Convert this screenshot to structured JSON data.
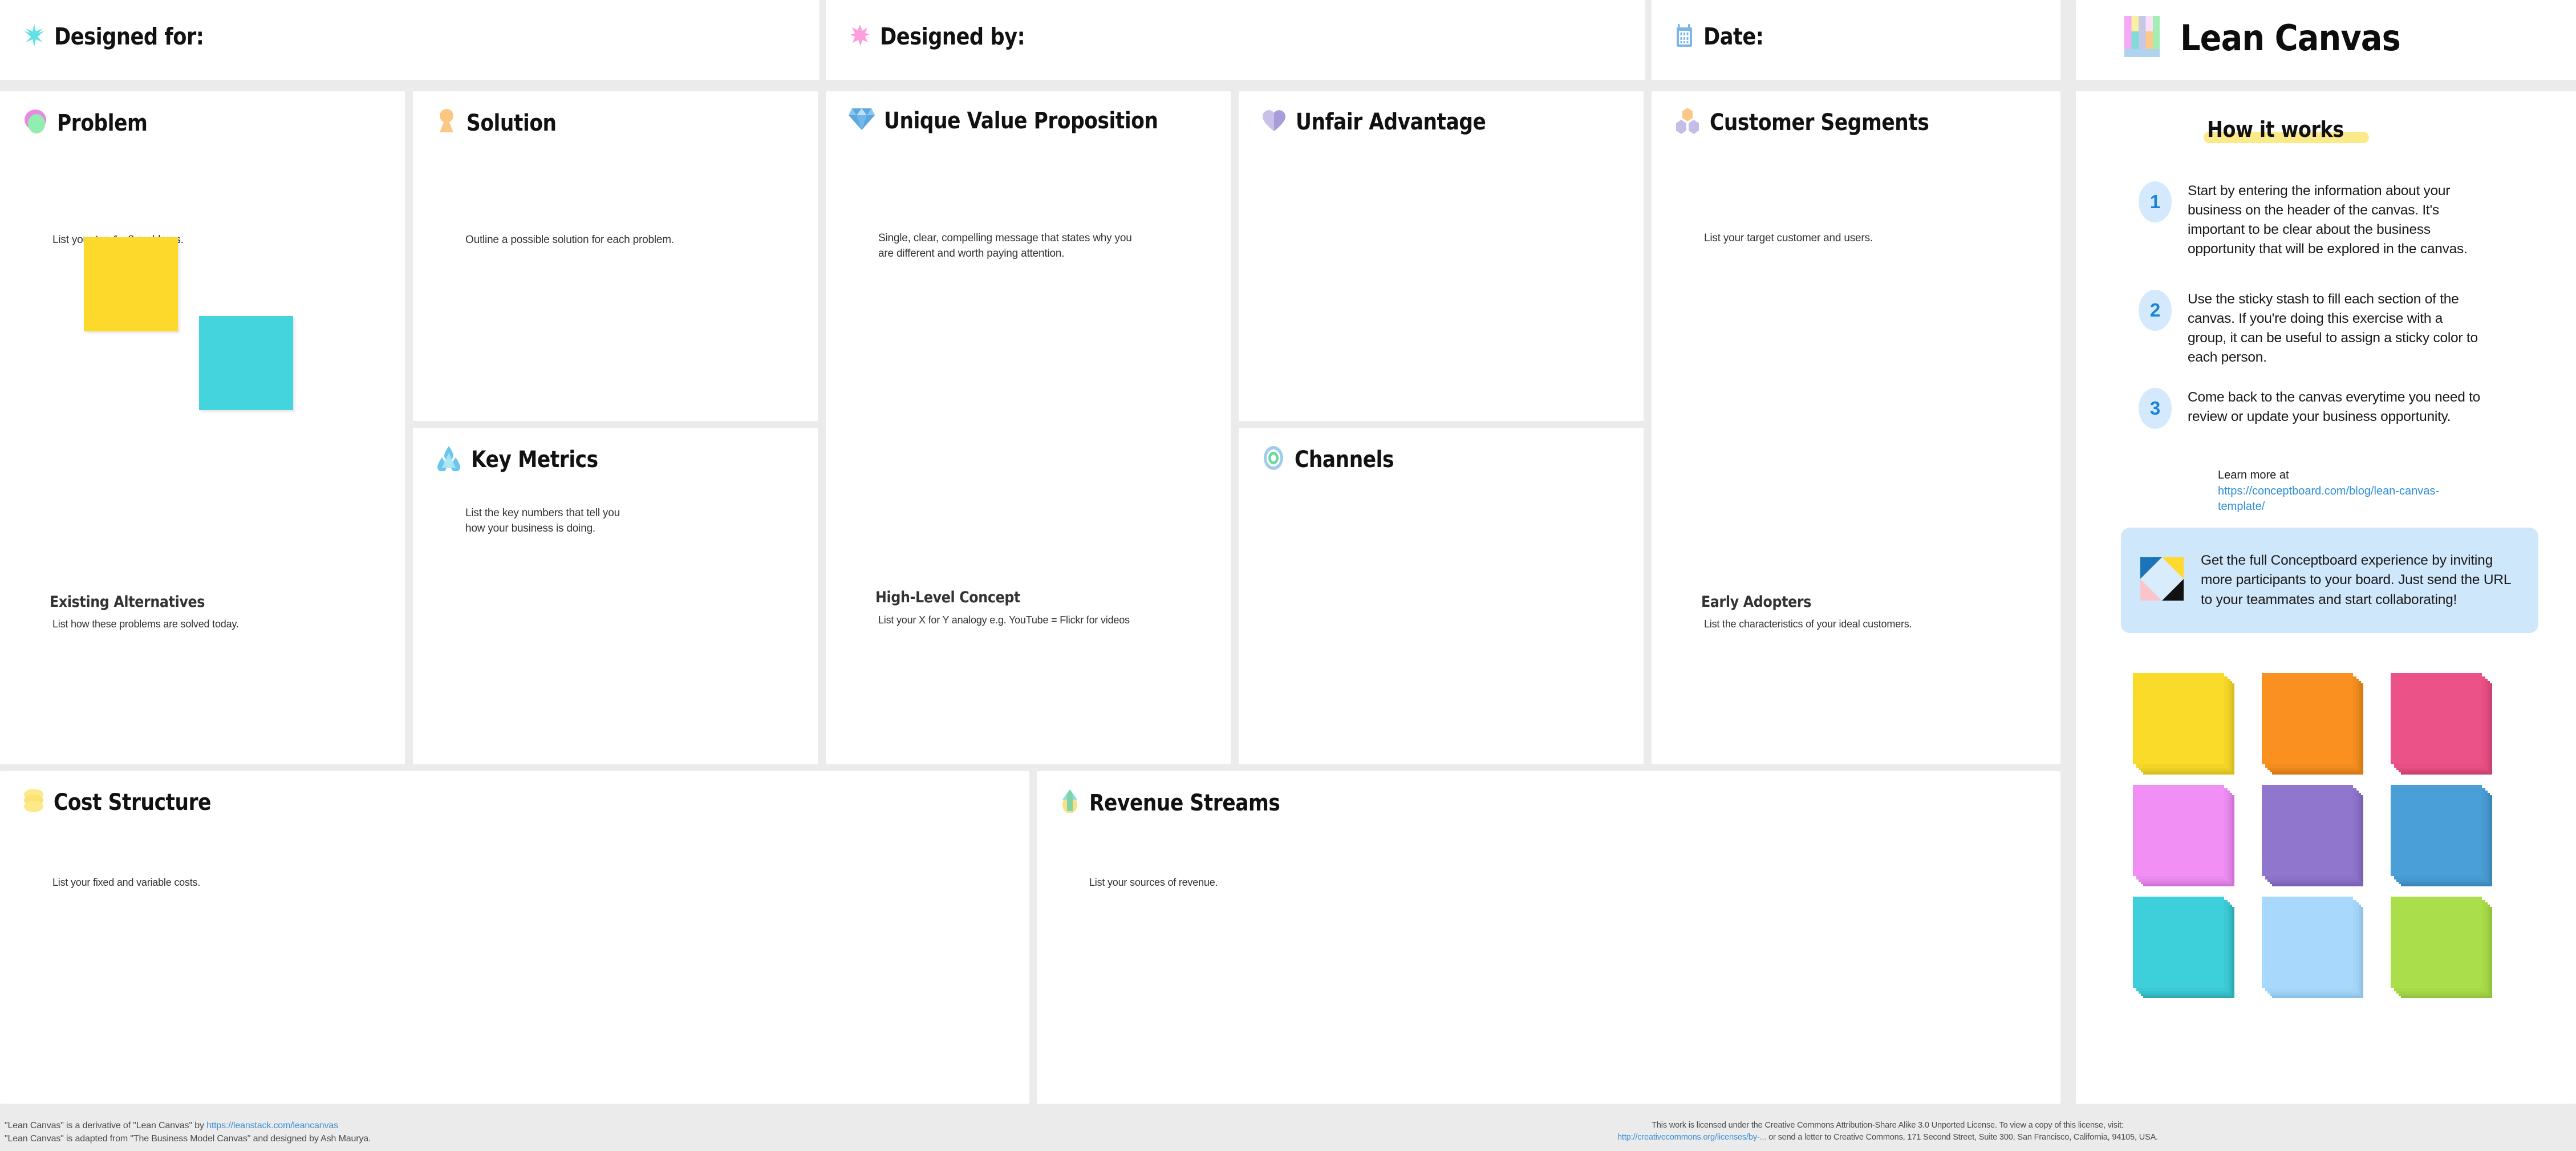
{
  "header": {
    "designed_for": {
      "label": "Designed for:",
      "icon": "asterisk-burst-icon",
      "color": "#5fe0e6"
    },
    "designed_by": {
      "label": "Designed by:",
      "icon": "star-burst-icon",
      "color": "#ff9ede"
    },
    "date": {
      "label": "Date:",
      "icon": "calendar-icon",
      "color": "#7cb6e8"
    },
    "brand": {
      "title": "Lean Canvas",
      "icon": "lean-canvas-logo-icon"
    }
  },
  "sections": {
    "problem": {
      "title": "Problem",
      "desc": "List your top 1 - 3 problems.",
      "icon": "oval-pink-green-icon",
      "sub_title": "Existing Alternatives",
      "sub_desc": "List how these problems are solved today."
    },
    "solution": {
      "title": "Solution",
      "desc": "Outline a possible solution for each problem.",
      "icon": "keyhole-icon"
    },
    "key_metrics": {
      "title": "Key Metrics",
      "desc": "List the key numbers that tell you\nhow your business is doing.",
      "icon": "three-droplets-icon"
    },
    "uvp": {
      "title": "Unique Value Proposition",
      "desc": "Single, clear, compelling message that states why you are different and worth paying attention.",
      "icon": "diamond-gem-icon",
      "sub_title": "High-Level Concept",
      "sub_desc": "List your X for Y analogy e.g. YouTube = Flickr for videos"
    },
    "unfair_advantage": {
      "title": "Unfair Advantage",
      "desc": "",
      "icon": "purple-heart-icon"
    },
    "channels": {
      "title": "Channels",
      "desc": "",
      "icon": "target-circles-icon"
    },
    "customer_segments": {
      "title": "Customer Segments",
      "desc": "List your target customer and users.",
      "icon": "three-hexagons-icon",
      "sub_title": "Early Adopters",
      "sub_desc": "List the characteristics of your ideal customers."
    },
    "cost_structure": {
      "title": "Cost Structure",
      "desc": "List your fixed and variable costs.",
      "icon": "stacked-coins-icon"
    },
    "revenue_streams": {
      "title": "Revenue Streams",
      "desc": "List your sources of revenue.",
      "icon": "up-arrow-icon"
    }
  },
  "how_it_works": {
    "title": "How it works",
    "steps": [
      {
        "number": "1",
        "text": "Start by entering the information about your business on the header of the canvas. It's important to be clear about the business opportunity that will be explored in the canvas."
      },
      {
        "number": "2",
        "text": "Use the sticky stash to fill each section of the canvas. If you're doing this exercise with a group, it can be useful to assign a sticky color to each person."
      },
      {
        "number": "3",
        "text": "Come back to the canvas everytime you need to review or update your business opportunity."
      }
    ],
    "learn_more_label": "Learn more at",
    "learn_more_url": "https://conceptboard.com/blog/lean-canvas-template/",
    "promo_text": "Get the full Conceptboard experience by inviting more participants to your board. Just send the URL to your teammates and start collaborating!",
    "promo_icon": "conceptboard-logo-icon"
  },
  "sticky_stash": {
    "colors": [
      {
        "name": "yellow",
        "hex": "#fbdb2a"
      },
      {
        "name": "orange",
        "hex": "#f99020"
      },
      {
        "name": "pink",
        "hex": "#eb5287"
      },
      {
        "name": "magenta",
        "hex": "#f18ff5"
      },
      {
        "name": "purple",
        "hex": "#9176cd"
      },
      {
        "name": "blue",
        "hex": "#4a9fd8"
      },
      {
        "name": "cyan",
        "hex": "#3ed0da"
      },
      {
        "name": "light-blue",
        "hex": "#a8d8fb"
      },
      {
        "name": "green",
        "hex": "#aade4b"
      }
    ]
  },
  "demo_stickies": [
    {
      "name": "yellow-demo-sticky",
      "hex": "#fcd92a"
    },
    {
      "name": "cyan-demo-sticky",
      "hex": "#44d4de"
    }
  ],
  "footer": {
    "left_line_1_prefix": "\"Lean Canvas\" is a derivative of \"Lean Canvas\" by ",
    "left_line_1_link": "https://leanstack.com/leancanvas",
    "left_line_2": "\"Lean Canvas\" is adapted from \"The Business Model Canvas\" and designed by Ash Maurya.",
    "right_line_1": "This work is licensed under the Creative Commons Attribution-Share Alike 3.0 Unported License. To view a copy of this license, visit:",
    "right_line_2_link": "http://creativecommons.org/licenses/by-...",
    "right_line_2_rest": " or send a letter to Creative Commons, 171 Second Street, Suite 300, San Francisco, California, 94105, USA."
  }
}
